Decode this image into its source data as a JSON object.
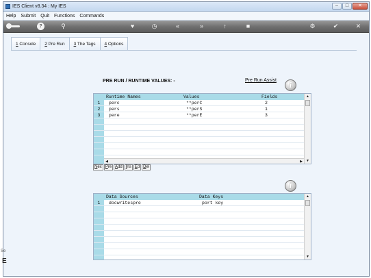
{
  "window": {
    "title": "IES Client v8.34 : My IES"
  },
  "menu": [
    "Help",
    "Submit",
    "Quit",
    "Functions",
    "Commands"
  ],
  "toolbar": {
    "icons": [
      "key-icon",
      "help-icon",
      "search-icon",
      "heart-icon",
      "clock-icon",
      "rewind-icon",
      "fast-forward-icon",
      "up-arrow-icon",
      "stop-icon",
      "settings-icon",
      "check-icon",
      "close-icon"
    ],
    "help_label": "?"
  },
  "tabs": [
    {
      "label": "1 Console",
      "key": "1",
      "rest": " Console"
    },
    {
      "label": "2 Pre Run",
      "key": "2",
      "rest": " Pre Run",
      "active": true
    },
    {
      "label": "3 The Tags",
      "key": "3",
      "rest": " The Tags"
    },
    {
      "label": "4 Options",
      "key": "4",
      "rest": " Options"
    }
  ],
  "prerun": {
    "title": "PRE RUN / RUNTIME VALUES: -",
    "assist_link": "Pre Run Assist",
    "columns": [
      "Runtime Names",
      "Values",
      "Fields"
    ],
    "rows": [
      {
        "num": "1",
        "name": "perc",
        "value": "**perC",
        "field": "2"
      },
      {
        "num": "2",
        "name": "pers",
        "value": "**perS",
        "field": "1"
      },
      {
        "num": "3",
        "name": "pere",
        "value": "**perE",
        "field": "3"
      }
    ],
    "buttons": [
      {
        "key": "N",
        "rest": "ex"
      },
      {
        "key": "P",
        "rest": "re"
      },
      {
        "key": "A",
        "rest": "dd"
      },
      {
        "key": "I",
        "rest": "ns"
      },
      {
        "key": "E",
        "rest": "d"
      },
      {
        "key": "D",
        "rest": "el"
      }
    ]
  },
  "datasources": {
    "columns": [
      "Data Sources",
      "Data Keys"
    ],
    "rows": [
      {
        "num": "1",
        "source": "docwritespre",
        "key": "port key"
      }
    ]
  },
  "info_icon": "i",
  "left_frame": {
    "text": "Se",
    "letter": "E"
  },
  "colors": {
    "grid_header": "#a9dbe8",
    "panel_bg": "#eef4fb",
    "toolbar": "#6e6e6e"
  }
}
